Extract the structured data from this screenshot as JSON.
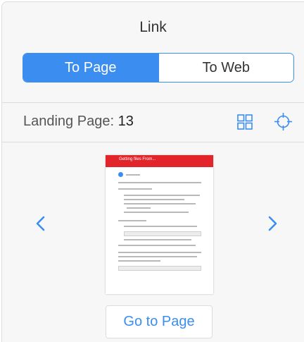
{
  "header": {
    "title": "Link"
  },
  "tabs": [
    {
      "label": "To Page",
      "active": true
    },
    {
      "label": "To Web",
      "active": false
    }
  ],
  "landing": {
    "label": "Landing Page:",
    "value": "13"
  },
  "preview": {
    "thumbnail_title": "Getting files From..."
  },
  "actions": {
    "go_to_page": "Go to Page"
  },
  "icons": {
    "grid": "grid-icon",
    "target": "target-icon",
    "prev": "chevron-left-icon",
    "next": "chevron-right-icon"
  },
  "colors": {
    "accent": "#3b8ef0",
    "thumb_header": "#e2252b"
  }
}
